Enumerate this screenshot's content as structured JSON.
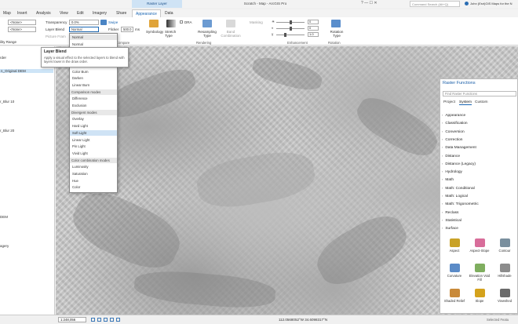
{
  "window": {
    "contextual_tab": "Raster Layer",
    "title": "Scratch - Map - ArcGIS Pro",
    "controls": "?  —  ☐  ✕",
    "search_placeholder": "Command Search (Alt+Q)",
    "user": "John (Esri)GIS Maps for the N"
  },
  "tabs": [
    "Map",
    "Insert",
    "Analysis",
    "View",
    "Edit",
    "Imagery",
    "Share",
    "Appearance",
    "Data"
  ],
  "active_tab": "Appearance",
  "ribbon": {
    "min_scale": "<None>",
    "max_scale": "<None>",
    "visibility_range_label": "ility Range",
    "transparency_label": "Transparency",
    "transparency_value": "0.0%",
    "layer_blend_label": "Layer Blend",
    "layer_blend_value": "Normal",
    "picture_frame_label": "Picture Fram",
    "swipe_label": "Swipe",
    "flicker_label": "Flicker",
    "flicker_value": "500.0",
    "flicker_unit": "ms",
    "compare_label": "Compare",
    "symbology_label": "Symbology",
    "stretch_type_label": "Stretch Type",
    "dra_label": "DRA",
    "resampling_type_label": "Resampling Type",
    "band_combination_label": "Band Combination",
    "masking_label": "Masking",
    "rendering_group_label": "Rendering",
    "enhancement_group_label": "Enhancement",
    "spin_values": [
      "0",
      "0",
      "1.0"
    ],
    "rotation_type_label": "Rotation Type",
    "rotation_group_label": "Rotation"
  },
  "tooltip": {
    "title": "Layer Blend",
    "text": "Apply a visual effect to the selected layers to blend with layers lower in the draw order."
  },
  "blend_list": {
    "items": [
      {
        "type": "item",
        "label": "Normal",
        "state": "top"
      },
      {
        "type": "item",
        "label": "Normal"
      },
      {
        "type": "item",
        "label": "Linear Dodge"
      },
      {
        "type": "head",
        "label": "Darkening modes"
      },
      {
        "type": "item",
        "label": "Multiply"
      },
      {
        "type": "item",
        "label": "Color Burn"
      },
      {
        "type": "item",
        "label": "Darken"
      },
      {
        "type": "item",
        "label": "Linear Burn"
      },
      {
        "type": "head",
        "label": "Comparison modes"
      },
      {
        "type": "item",
        "label": "Difference"
      },
      {
        "type": "item",
        "label": "Exclusion"
      },
      {
        "type": "head",
        "label": "Divergent modes"
      },
      {
        "type": "item",
        "label": "Overlay"
      },
      {
        "type": "item",
        "label": "Hard Light"
      },
      {
        "type": "item",
        "label": "Soft Light",
        "state": "hl"
      },
      {
        "type": "item",
        "label": "Linear Light"
      },
      {
        "type": "item",
        "label": "Pin Light"
      },
      {
        "type": "item",
        "label": "Vivid Light"
      },
      {
        "type": "head",
        "label": "Color combination modes"
      },
      {
        "type": "item",
        "label": "Luminosity"
      },
      {
        "type": "item",
        "label": "Saturation"
      },
      {
        "type": "item",
        "label": "Hue"
      },
      {
        "type": "item",
        "label": "Color"
      }
    ]
  },
  "left_pane": {
    "items": [
      "rder",
      "n_Original DEM",
      "r_Blur 10",
      "r_Blur 20",
      "DEM",
      "agery"
    ],
    "selected_index": 1
  },
  "raster_functions": {
    "title": "Raster Functions",
    "search_placeholder": "Find Raster Functions",
    "tabs": [
      "Project",
      "System",
      "Custom"
    ],
    "active_tab": "System",
    "categories": [
      "Appearance",
      "Classification",
      "Conversion",
      "Correction",
      "Data Management",
      "Distance",
      "Distance (Legacy)",
      "Hydrology",
      "Math",
      "Math: Conditional",
      "Math: Logical",
      "Math: Trigonometric",
      "Reclass",
      "Statistical",
      "Surface"
    ],
    "tools": [
      {
        "label": "Aspect",
        "color": "#c9a227"
      },
      {
        "label": "Aspect-Slope",
        "color": "#d86d9a"
      },
      {
        "label": "Contour",
        "color": "#7a8f9e"
      },
      {
        "label": "Curvature",
        "color": "#5b8bc7"
      },
      {
        "label": "Elevation Void Fill",
        "color": "#7fae5f"
      },
      {
        "label": "Hillshade",
        "color": "#8c8c8c"
      },
      {
        "label": "Shaded Relief",
        "color": "#c98a3a"
      },
      {
        "label": "Slope",
        "color": "#d4a21c"
      },
      {
        "label": "Viewshed",
        "color": "#6a6a6a"
      }
    ]
  },
  "status": {
    "scale": "1:248,056",
    "coordinates": "112.0568052°W 34.6098317°N",
    "selected_features": "Selected Featu"
  }
}
